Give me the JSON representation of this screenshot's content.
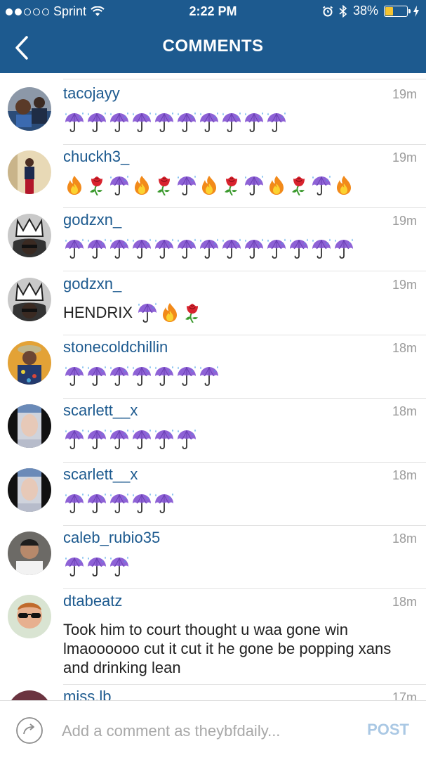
{
  "status_bar": {
    "carrier": "Sprint",
    "time": "2:22 PM",
    "battery": "38%",
    "battery_level": 0.38,
    "signal_bars_filled": 2,
    "signal_bars_total": 5
  },
  "nav": {
    "title": "COMMENTS",
    "back_icon": "chevron-left-icon"
  },
  "emoji_legend": {
    "U": "umbrella-rain-emoji",
    "F": "fire-emoji",
    "R": "rose-emoji"
  },
  "comments": [
    {
      "username": "tacojayy",
      "time": "19m",
      "text": "",
      "emojis": "UUUUUUUUUU"
    },
    {
      "username": "chuckh3_",
      "time": "19m",
      "text": "",
      "emojis": "FRUFRUFRUFRUF"
    },
    {
      "username": "godzxn_",
      "time": "19m",
      "text": "",
      "emojis": "UUUUUUUUUUUUU"
    },
    {
      "username": "godzxn_",
      "time": "19m",
      "text": "HENDRIX",
      "emojis": "UFR"
    },
    {
      "username": "stonecoldchillin",
      "time": "18m",
      "text": "",
      "emojis": "UUUUUUU"
    },
    {
      "username": "scarlett__x",
      "time": "18m",
      "text": "",
      "emojis": "UUUUUU"
    },
    {
      "username": "scarlett__x",
      "time": "18m",
      "text": "",
      "emojis": "UUUUU"
    },
    {
      "username": "caleb_rubio35",
      "time": "18m",
      "text": "",
      "emojis": "UUU"
    },
    {
      "username": "dtabeatz",
      "time": "18m",
      "text": "Took him to court thought u waa gone win lmaoooooo cut it cut it he gone be popping xans and drinking lean",
      "emojis": ""
    },
    {
      "username": "miss.lb",
      "time": "17m",
      "text": "",
      "emojis": ""
    }
  ],
  "composer": {
    "placeholder": "Add a comment as theybfdaily...",
    "post_label": "POST"
  },
  "colors": {
    "nav_bg": "#1d5a8f",
    "username": "#1d5a8f",
    "time": "#9a9a9a",
    "post_disabled": "#aac8e4",
    "battery_fill": "#f5c431"
  }
}
